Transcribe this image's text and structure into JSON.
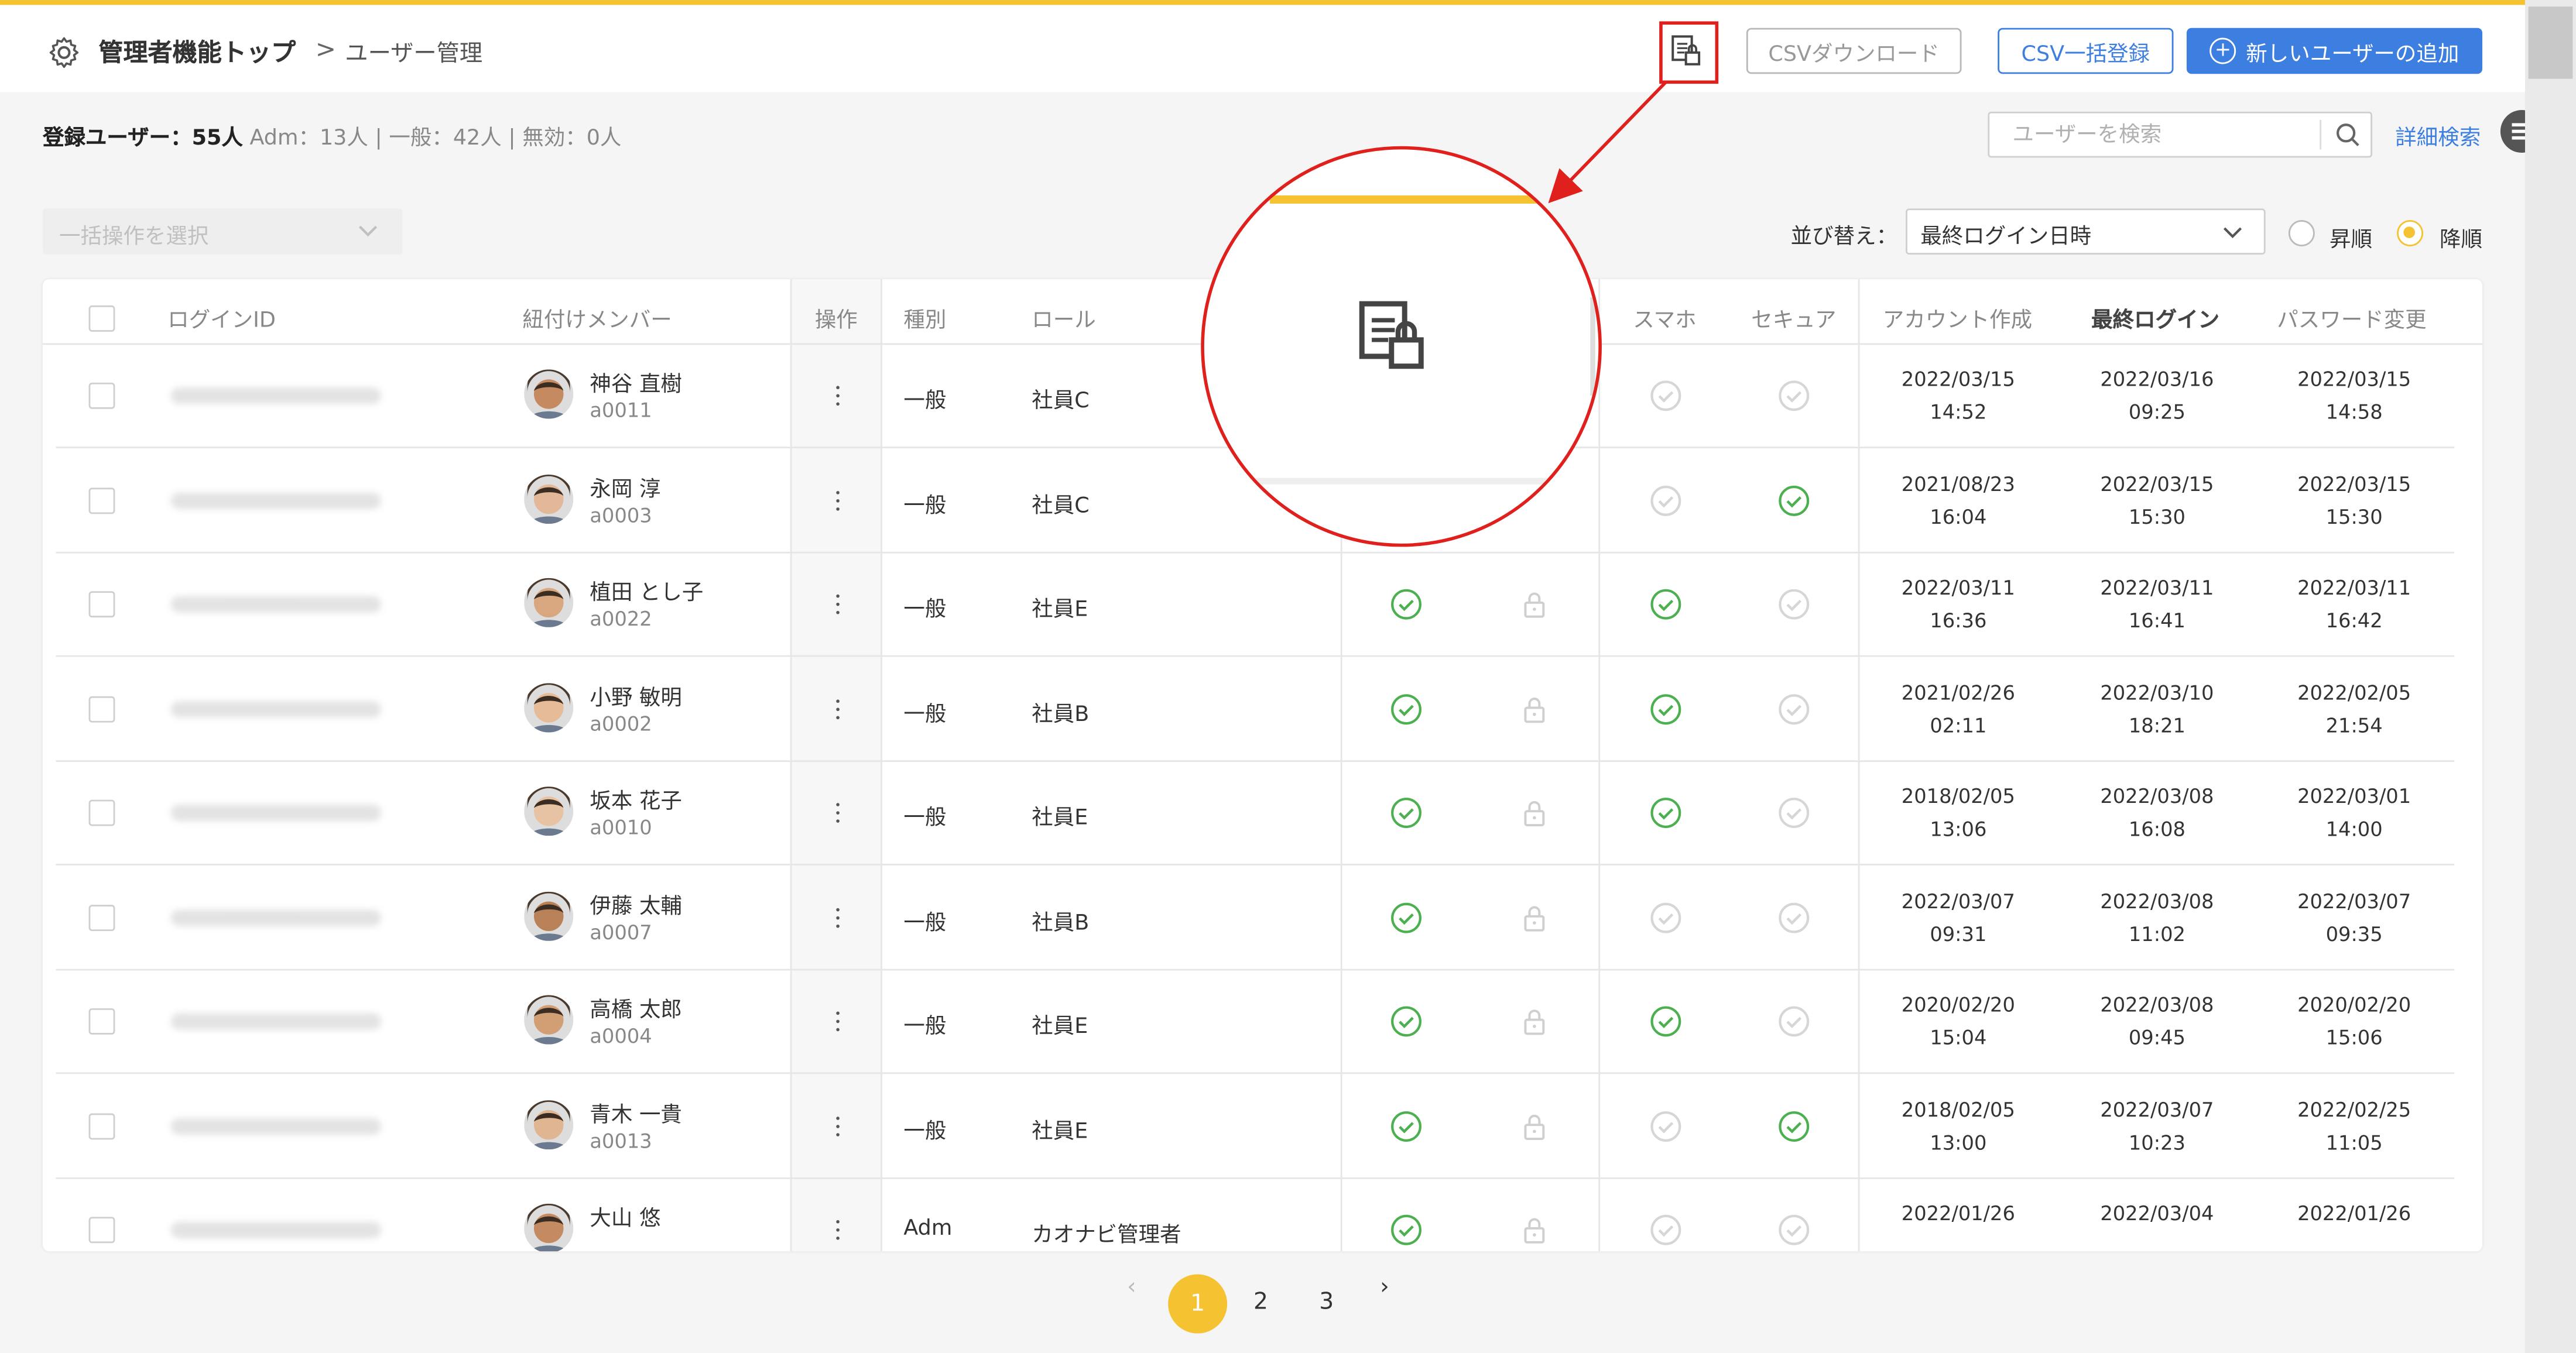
{
  "header": {
    "breadcrumb_top": "管理者機能トップ",
    "breadcrumb_sep": ">",
    "breadcrumb_current": "ユーザー管理",
    "csv_download": "CSVダウンロード",
    "csv_register": "CSV一括登録",
    "add_user": "新しいユーザーの追加",
    "icon_lock_doc": "document-lock-icon",
    "accent_color": "#f5c232",
    "primary_color": "#3d7fe0",
    "highlight_color": "#e0201d"
  },
  "summary": {
    "label": "登録ユーザー：55人",
    "adm": "Adm：13人",
    "general": "一般：42人",
    "invalid": "無効：0人"
  },
  "search": {
    "placeholder": "ユーザーを検索",
    "advanced": "詳細検索"
  },
  "toolbar": {
    "bulk_placeholder": "一括操作を選択",
    "sort_label": "並び替え：",
    "sort_value": "最終ログイン日時",
    "asc": "昇順",
    "desc": "降順"
  },
  "table": {
    "headers": {
      "login_id": "ログインID",
      "member": "紐付けメンバー",
      "ops": "操作",
      "type": "種別",
      "role": "ロール",
      "smartphone": "スマホ",
      "secure": "セキュア",
      "created": "アカウント作成",
      "last_login": "最終ログイン",
      "pw_change": "パスワード変更"
    },
    "rows": [
      {
        "name": "神谷 直樹",
        "id": "a0011",
        "type": "一般",
        "role": "社員C",
        "c1": "",
        "c2": "",
        "sp": "off",
        "sec": "off",
        "created_d": "2022/03/15",
        "created_t": "14:52",
        "login_d": "2022/03/16",
        "login_t": "09:25",
        "pw_d": "2022/03/15",
        "pw_t": "14:58"
      },
      {
        "name": "永岡 淳",
        "id": "a0003",
        "type": "一般",
        "role": "社員C",
        "c1": "",
        "c2": "",
        "sp": "off",
        "sec": "on",
        "created_d": "2021/08/23",
        "created_t": "16:04",
        "login_d": "2022/03/15",
        "login_t": "15:30",
        "pw_d": "2022/03/15",
        "pw_t": "15:30"
      },
      {
        "name": "植田 とし子",
        "id": "a0022",
        "type": "一般",
        "role": "社員E",
        "c1": "on",
        "c2": "lock",
        "sp": "on",
        "sec": "off",
        "created_d": "2022/03/11",
        "created_t": "16:36",
        "login_d": "2022/03/11",
        "login_t": "16:41",
        "pw_d": "2022/03/11",
        "pw_t": "16:42"
      },
      {
        "name": "小野 敏明",
        "id": "a0002",
        "type": "一般",
        "role": "社員B",
        "c1": "on",
        "c2": "lock",
        "sp": "on",
        "sec": "off",
        "created_d": "2021/02/26",
        "created_t": "02:11",
        "login_d": "2022/03/10",
        "login_t": "18:21",
        "pw_d": "2022/02/05",
        "pw_t": "21:54"
      },
      {
        "name": "坂本 花子",
        "id": "a0010",
        "type": "一般",
        "role": "社員E",
        "c1": "on",
        "c2": "lock",
        "sp": "on",
        "sec": "off",
        "created_d": "2018/02/05",
        "created_t": "13:06",
        "login_d": "2022/03/08",
        "login_t": "16:08",
        "pw_d": "2022/03/01",
        "pw_t": "14:00"
      },
      {
        "name": "伊藤 太輔",
        "id": "a0007",
        "type": "一般",
        "role": "社員B",
        "c1": "on",
        "c2": "lock",
        "sp": "off",
        "sec": "off",
        "created_d": "2022/03/07",
        "created_t": "09:31",
        "login_d": "2022/03/08",
        "login_t": "11:02",
        "pw_d": "2022/03/07",
        "pw_t": "09:35"
      },
      {
        "name": "高橋 太郎",
        "id": "a0004",
        "type": "一般",
        "role": "社員E",
        "c1": "on",
        "c2": "lock",
        "sp": "on",
        "sec": "off",
        "created_d": "2020/02/20",
        "created_t": "15:04",
        "login_d": "2022/03/08",
        "login_t": "09:45",
        "pw_d": "2020/02/20",
        "pw_t": "15:06"
      },
      {
        "name": "青木 一貴",
        "id": "a0013",
        "type": "一般",
        "role": "社員E",
        "c1": "on",
        "c2": "lock",
        "sp": "off",
        "sec": "on",
        "created_d": "2018/02/05",
        "created_t": "13:00",
        "login_d": "2022/03/07",
        "login_t": "10:23",
        "pw_d": "2022/02/25",
        "pw_t": "11:05"
      },
      {
        "name": "大山 悠",
        "id": "",
        "type": "Adm",
        "role": "カオナビ管理者",
        "c1": "on",
        "c2": "lock",
        "sp": "off",
        "sec": "off",
        "created_d": "2022/01/26",
        "created_t": "",
        "login_d": "2022/03/04",
        "login_t": "",
        "pw_d": "2022/01/26",
        "pw_t": ""
      }
    ]
  },
  "pagination": {
    "pages": [
      "1",
      "2",
      "3"
    ],
    "current": "1",
    "prev": "‹",
    "next": "›"
  }
}
